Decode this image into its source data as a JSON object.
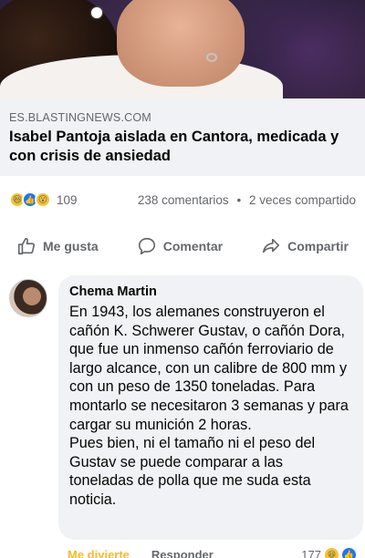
{
  "post": {
    "link": {
      "domain": "ES.BLASTINGNEWS.COM",
      "headline": "Isabel Pantoja aislada en Cantora, medicada y con crisis de ansiedad"
    },
    "reactions": {
      "icons": [
        "haha",
        "like",
        "wow"
      ],
      "count": "109"
    },
    "comments_count": "238 comentarios",
    "shares": "2 veces compartido",
    "separator": "•",
    "actions": {
      "like": "Me gusta",
      "comment": "Comentar",
      "share": "Compartir"
    }
  },
  "comment": {
    "author": "Chema Martin",
    "text": "En 1943, los alemanes construyeron el cañón K. Schwerer Gustav, o cañón Dora, que fue un inmenso cañón ferroviario de largo alcance, con un calibre de 800 mm y con un peso de 1350 toneladas. Para montarlo se necesitaron 3 semanas y para cargar su munición 2 horas.\nPues bien, ni el tamaño ni el peso del Gustav se puede comparar a las toneladas de polla que me suda esta noticia.",
    "footer": {
      "like_label": "Me divierte",
      "reply_label": "Responder",
      "reaction_count": "177"
    }
  },
  "colors": {
    "accent": "#1877f2",
    "haha": "#f7c32e",
    "muted": "#65676b",
    "bubble": "#f0f2f5"
  }
}
